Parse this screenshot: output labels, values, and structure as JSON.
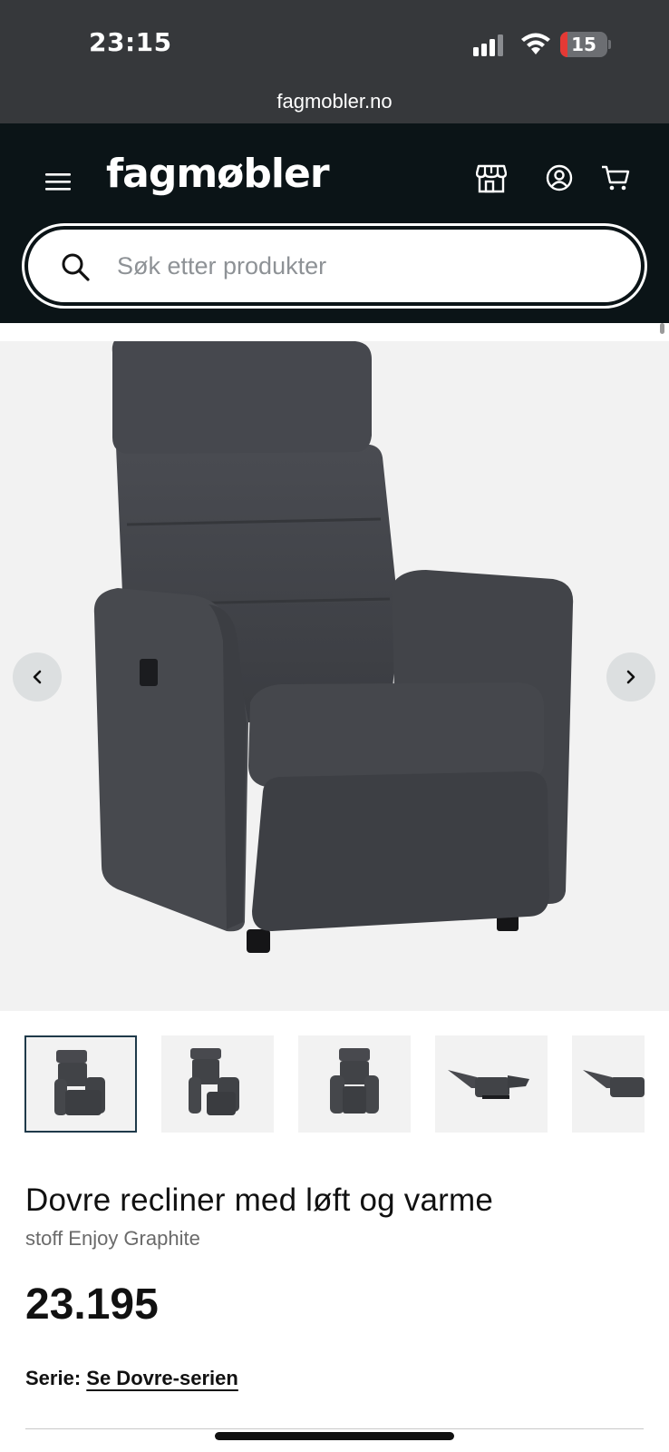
{
  "status_bar": {
    "time": "23:15",
    "battery_level": "15",
    "battery_fraction": 0.15,
    "battery_color": "#e53935"
  },
  "browser": {
    "url": "fagmobler.no"
  },
  "header": {
    "logo": "fagmøbler",
    "background": "#0b1417",
    "icons": [
      "menu-icon",
      "store-icon",
      "account-icon",
      "cart-icon"
    ]
  },
  "search": {
    "placeholder": "Søk etter produkter",
    "icon": "search-icon"
  },
  "gallery": {
    "nav": [
      "chevron-left-icon",
      "chevron-right-icon"
    ],
    "thumbnail_count_visible": 5,
    "active_thumbnail": 1
  },
  "product": {
    "title": "Dovre recliner med løft og varme",
    "subtitle": "stoff Enjoy Graphite",
    "price": "23.195",
    "series_label": "Serie:",
    "series_link": "Se Dovre-serien"
  }
}
